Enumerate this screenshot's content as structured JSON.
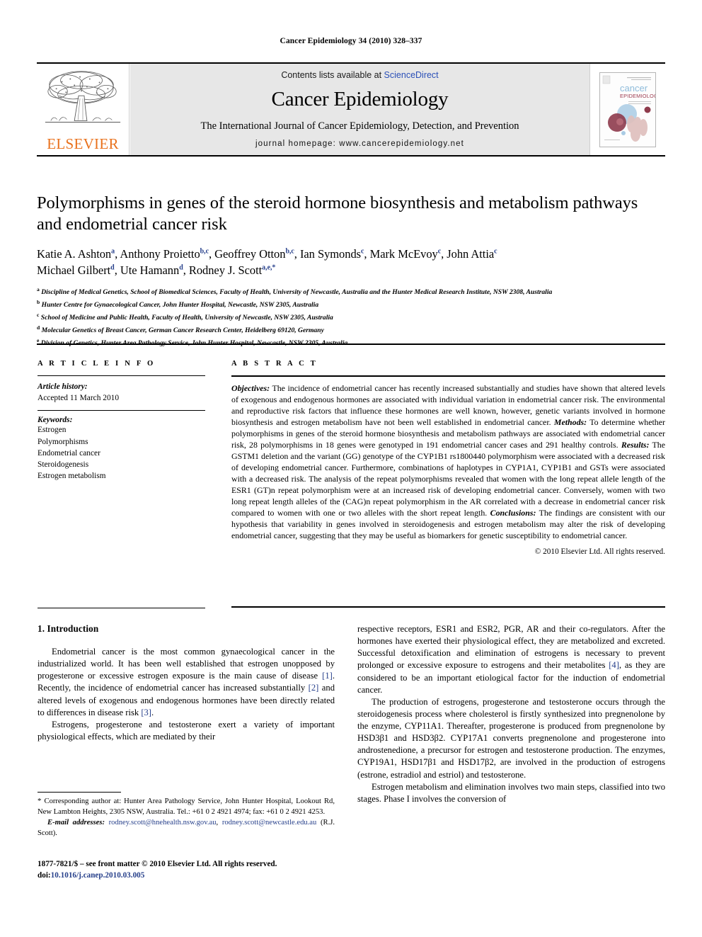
{
  "running_head": "Cancer Epidemiology 34 (2010) 328–337",
  "masthead": {
    "publisher_name": "ELSEVIER",
    "contents_prefix": "Contents lists available at ",
    "contents_link": "ScienceDirect",
    "journal_title": "Cancer Epidemiology",
    "journal_subtitle": "The International Journal of Cancer Epidemiology, Detection, and Prevention",
    "homepage": "journal homepage: www.cancerepidemiology.net",
    "cover_title_line1": "cancer",
    "cover_title_line2": "EPIDEMIOLOGY",
    "cover_sub": "The International Journal of Cancer Epidemiology, Detection, and Prevention",
    "link_color": "#2a4fb7",
    "brand_color": "#E9711C"
  },
  "article": {
    "title": "Polymorphisms in genes of the steroid hormone biosynthesis and metabolism pathways and endometrial cancer risk",
    "authors_line1_parts": [
      {
        "name": "Katie A. Ashton",
        "sup": "a"
      },
      {
        "name": "Anthony Proietto",
        "sup": "b,c"
      },
      {
        "name": "Geoffrey Otton",
        "sup": "b,c"
      },
      {
        "name": "Ian Symonds",
        "sup": "c"
      },
      {
        "name": "Mark McEvoy",
        "sup": "c"
      },
      {
        "name": "John Attia",
        "sup": "c"
      }
    ],
    "authors_line2_parts": [
      {
        "name": "Michael Gilbert",
        "sup": "d"
      },
      {
        "name": "Ute Hamann",
        "sup": "d"
      },
      {
        "name": "Rodney J. Scott",
        "sup": "a,e,*"
      }
    ],
    "affiliations": [
      {
        "mark": "a",
        "text": "Discipline of Medical Genetics, School of Biomedical Sciences, Faculty of Health, University of Newcastle, Australia and the Hunter Medical Research Institute, NSW 2308, Australia"
      },
      {
        "mark": "b",
        "text": "Hunter Centre for Gynaecological Cancer, John Hunter Hospital, Newcastle, NSW 2305, Australia"
      },
      {
        "mark": "c",
        "text": "School of Medicine and Public Health, Faculty of Health, University of Newcastle, NSW 2305, Australia"
      },
      {
        "mark": "d",
        "text": "Molecular Genetics of Breast Cancer, German Cancer Research Center, Heidelberg 69120, Germany"
      },
      {
        "mark": "e",
        "text": "Division of Genetics, Hunter Area Pathology Service, John Hunter Hospital, Newcastle, NSW 2305, Australia"
      }
    ]
  },
  "article_info": {
    "heading": "A R T I C L E   I N F O",
    "history_label": "Article history:",
    "history_value": "Accepted 11 March 2010",
    "keywords_label": "Keywords:",
    "keywords": [
      "Estrogen",
      "Polymorphisms",
      "Endometrial cancer",
      "Steroidogenesis",
      "Estrogen metabolism"
    ]
  },
  "abstract": {
    "heading": "A B S T R A C T",
    "segments": [
      {
        "label": "Objectives:",
        "text": " The incidence of endometrial cancer has recently increased substantially and studies have shown that altered levels of exogenous and endogenous hormones are associated with individual variation in endometrial cancer risk. The environmental and reproductive risk factors that influence these hormones are well known, however, genetic variants involved in hormone biosynthesis and estrogen metabolism have not been well established in endometrial cancer. "
      },
      {
        "label": "Methods:",
        "text": " To determine whether polymorphisms in genes of the steroid hormone biosynthesis and metabolism pathways are associated with endometrial cancer risk, 28 polymorphisms in 18 genes were genotyped in 191 endometrial cancer cases and 291 healthy controls. "
      },
      {
        "label": "Results:",
        "text": " The GSTM1 deletion and the variant (GG) genotype of the CYP1B1 rs1800440 polymorphism were associated with a decreased risk of developing endometrial cancer. Furthermore, combinations of haplotypes in CYP1A1, CYP1B1 and GSTs were associated with a decreased risk. The analysis of the repeat polymorphisms revealed that women with the long repeat allele length of the ESR1 (GT)n repeat polymorphism were at an increased risk of developing endometrial cancer. Conversely, women with two long repeat length alleles of the (CAG)n repeat polymorphism in the AR correlated with a decrease in endometrial cancer risk compared to women with one or two alleles with the short repeat length. "
      },
      {
        "label": "Conclusions:",
        "text": " The findings are consistent with our hypothesis that variability in genes involved in steroidogenesis and estrogen metabolism may alter the risk of developing endometrial cancer, suggesting that they may be useful as biomarkers for genetic susceptibility to endometrial cancer."
      }
    ],
    "copyright": "© 2010 Elsevier Ltd. All rights reserved."
  },
  "body": {
    "section_heading": "1. Introduction",
    "left_paragraphs": [
      {
        "parts": [
          {
            "t": "Endometrial cancer is the most common gynaecological cancer in the industrialized world. It has been well established that estrogen unopposed by progesterone or excessive estrogen exposure is the main cause of disease "
          },
          {
            "t": "[1]",
            "ref": true
          },
          {
            "t": ". Recently, the incidence of endometrial cancer has increased substantially "
          },
          {
            "t": "[2]",
            "ref": true
          },
          {
            "t": " and altered levels of exogenous and endogenous hormones have been directly related to differences in disease risk "
          },
          {
            "t": "[3]",
            "ref": true
          },
          {
            "t": "."
          }
        ]
      },
      {
        "parts": [
          {
            "t": "Estrogens, progesterone and testosterone exert a variety of important physiological effects, which are mediated by their"
          }
        ]
      }
    ],
    "right_paragraphs": [
      {
        "indent": false,
        "parts": [
          {
            "t": "respective receptors, ESR1 and ESR2, PGR, AR and their co-regulators. After the hormones have exerted their physiological effect, they are metabolized and excreted. Successful detoxification and elimination of estrogens is necessary to prevent prolonged or excessive exposure to estrogens and their metabolites "
          },
          {
            "t": "[4]",
            "ref": true
          },
          {
            "t": ", as they are considered to be an important etiological factor for the induction of endometrial cancer."
          }
        ]
      },
      {
        "indent": true,
        "parts": [
          {
            "t": "The production of estrogens, progesterone and testosterone occurs through the steroidogenesis process where cholesterol is firstly synthesized into pregnenolone by the enzyme, CYP11A1. Thereafter, progesterone is produced from pregnenolone by HSD3β1 and HSD3β2. CYP17A1 converts pregnenolone and progesterone into androstenedione, a precursor for estrogen and testosterone production. The enzymes, CYP19A1, HSD17β1 and HSD17β2, are involved in the production of estrogens (estrone, estradiol and estriol) and testosterone."
          }
        ]
      },
      {
        "indent": true,
        "parts": [
          {
            "t": "Estrogen metabolism and elimination involves two main steps, classified into two stages. Phase I involves the conversion of"
          }
        ]
      }
    ]
  },
  "footnotes": {
    "corresponding": "Corresponding author at: Hunter Area Pathology Service, John Hunter Hospital, Lookout Rd, New Lambton Heights, 2305 NSW, Australia. Tel.: +61 0 2 4921 4974; fax: +61 0 2 4921 4253.",
    "email_label": "E-mail addresses:",
    "email1": "rodney.scott@hnehealth.nsw.gov.au",
    "email2": "rodney.scott@newcastle.edu.au",
    "email_suffix": "(R.J. Scott)."
  },
  "issn": {
    "line1": "1877-7821/$ – see front matter © 2010 Elsevier Ltd. All rights reserved.",
    "doi_prefix": "doi:",
    "doi": "10.1016/j.canep.2010.03.005"
  }
}
